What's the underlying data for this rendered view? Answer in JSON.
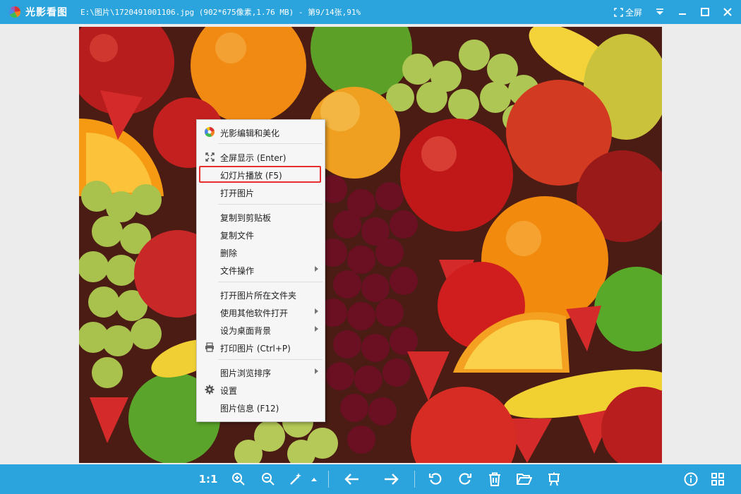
{
  "titlebar": {
    "app_name": "光影看图",
    "file_info": "E:\\图片\\1720491001106.jpg (902*675像素,1.76 MB) - 第9/14张,91%",
    "fullscreen_label": "全屏"
  },
  "context_menu": {
    "items": [
      {
        "label": "光影编辑和美化",
        "icon": "color-wheel-icon"
      },
      {
        "label": "全屏显示 (Enter)",
        "icon": "expand-icon"
      },
      {
        "label": "幻灯片播放 (F5)",
        "highlighted": true
      },
      {
        "label": "打开图片"
      },
      {
        "label": "复制到剪贴板"
      },
      {
        "label": "复制文件"
      },
      {
        "label": "删除"
      },
      {
        "label": "文件操作",
        "submenu": true
      },
      {
        "label": "打开图片所在文件夹"
      },
      {
        "label": "使用其他软件打开",
        "submenu": true
      },
      {
        "label": "设为桌面背景",
        "submenu": true
      },
      {
        "label": "打印图片 (Ctrl+P)",
        "icon": "printer-icon"
      },
      {
        "label": "图片浏览排序",
        "submenu": true
      },
      {
        "label": "设置",
        "icon": "gear-icon"
      },
      {
        "label": "图片信息 (F12)"
      }
    ]
  },
  "toolbar": {
    "actual_size_label": "1:1"
  },
  "colors": {
    "accent": "#2ba3dc",
    "highlight_border": "#e53030"
  }
}
